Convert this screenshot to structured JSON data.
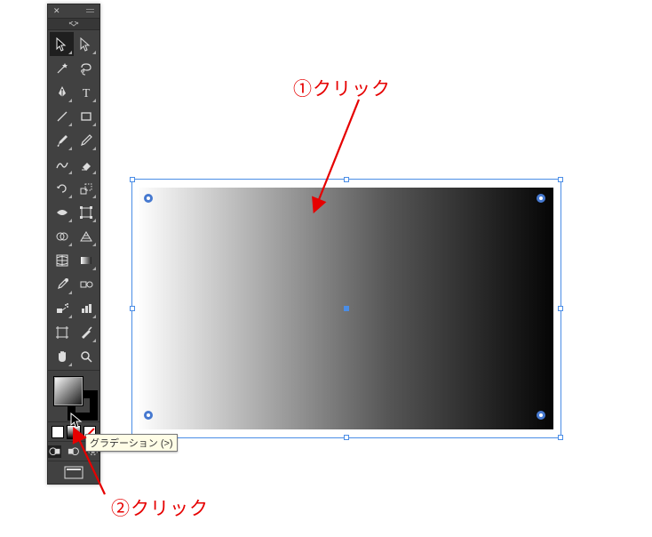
{
  "annotation": {
    "step1_label": "①クリック",
    "step2_label": "②クリック"
  },
  "tooltip": {
    "gradient": "グラデーション (>)"
  },
  "tools_left": [
    "selection-tool",
    "magic-wand-tool",
    "pen-tool",
    "line-segment-tool",
    "paintbrush-tool",
    "shaper-tool",
    "rotate-tool",
    "width-tool",
    "shape-builder-tool",
    "mesh-tool",
    "eyedropper-tool",
    "symbol-sprayer-tool",
    "artboard-tool",
    "hand-tool"
  ],
  "tools_right": [
    "direct-selection-tool",
    "lasso-tool",
    "type-tool",
    "rectangle-tool",
    "pencil-tool",
    "eraser-tool",
    "scale-tool",
    "free-transform-tool",
    "perspective-grid-tool",
    "gradient-tool",
    "blend-tool",
    "column-graph-tool",
    "slice-tool",
    "zoom-tool"
  ],
  "selected_tool": "selection-tool",
  "fill_mode_selected": "gradient",
  "colors": {
    "selection_blue": "#4a8de6",
    "anchor_blue": "#4679d0",
    "annot_red": "#e60000",
    "tooltip_bg": "#fffde6"
  }
}
